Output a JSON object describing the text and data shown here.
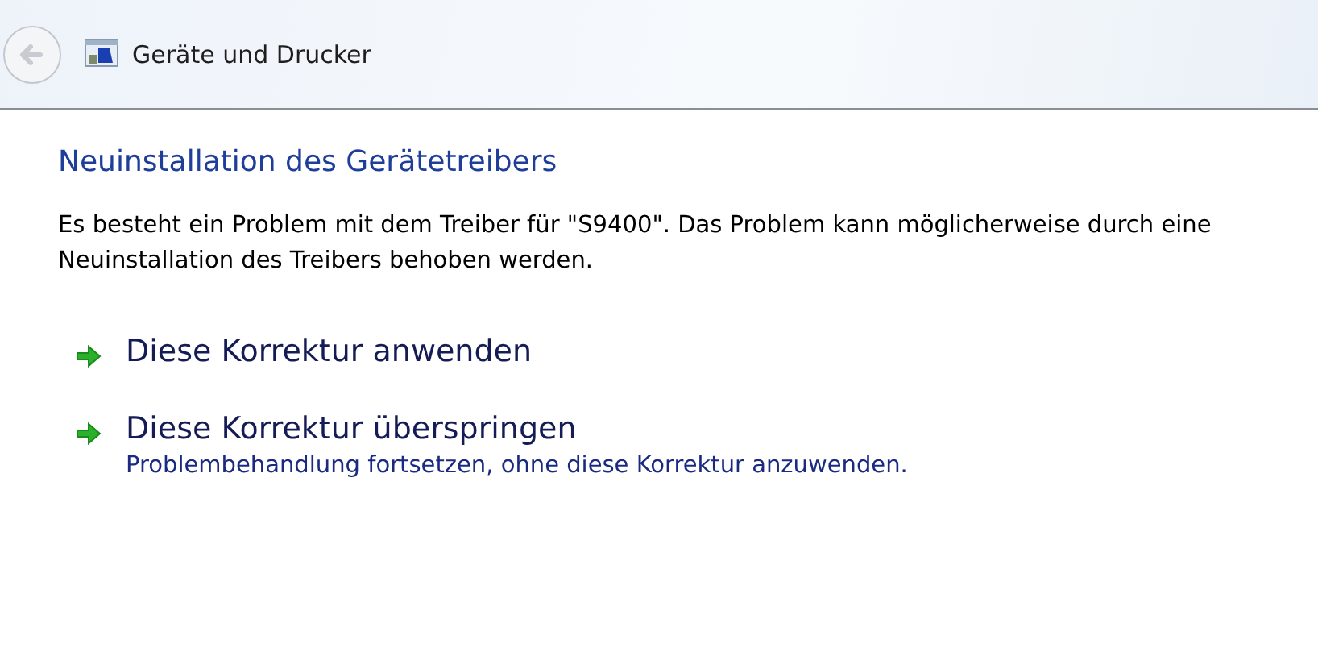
{
  "header": {
    "title": "Geräte und Drucker"
  },
  "heading": "Neuinstallation des Gerätetreibers",
  "message": "Es besteht ein Problem mit dem Treiber für \"S9400\". Das Problem kann möglicherweise durch eine Neuinstallation des Treibers behoben werden.",
  "options": [
    {
      "label": "Diese Korrektur anwenden"
    },
    {
      "label": "Diese Korrektur überspringen",
      "description": "Problembehandlung fortsetzen, ohne diese Korrektur anzuwenden."
    }
  ]
}
